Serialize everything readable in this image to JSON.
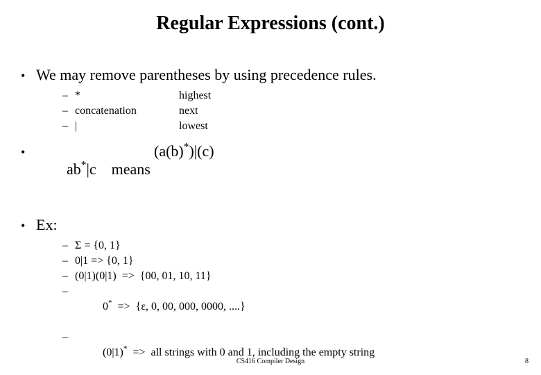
{
  "title": "Regular Expressions (cont.)",
  "bullet1": "We may remove parentheses by using precedence rules.",
  "precedence": [
    {
      "op": "*",
      "level": "highest"
    },
    {
      "op": "concatenation",
      "level": "next"
    },
    {
      "op": "|",
      "level": "lowest"
    }
  ],
  "means": {
    "left_a": "ab",
    "left_sup": "*",
    "left_b": "|c    means",
    "right_a": "(a(b)",
    "right_sup": "*",
    "right_b": ")|(c)"
  },
  "ex_label": "Ex:",
  "examples": {
    "e1_a": "Σ = {0, 1}",
    "e2_a": "0|1 => {0, 1}",
    "e3_a": "(0|1)(0|1)  =>  {00, 01, 10, 11}",
    "e4_a": "0",
    "e4_sup": "*",
    "e4_b": "  =>  {ε, 0, 00, 000, 0000, ....}",
    "e5_a": "(0|1)",
    "e5_sup": "*",
    "e5_b": "  =>  all strings with 0 and 1, including the empty string"
  },
  "footer": "CS416 Compiler Design",
  "page": "8"
}
